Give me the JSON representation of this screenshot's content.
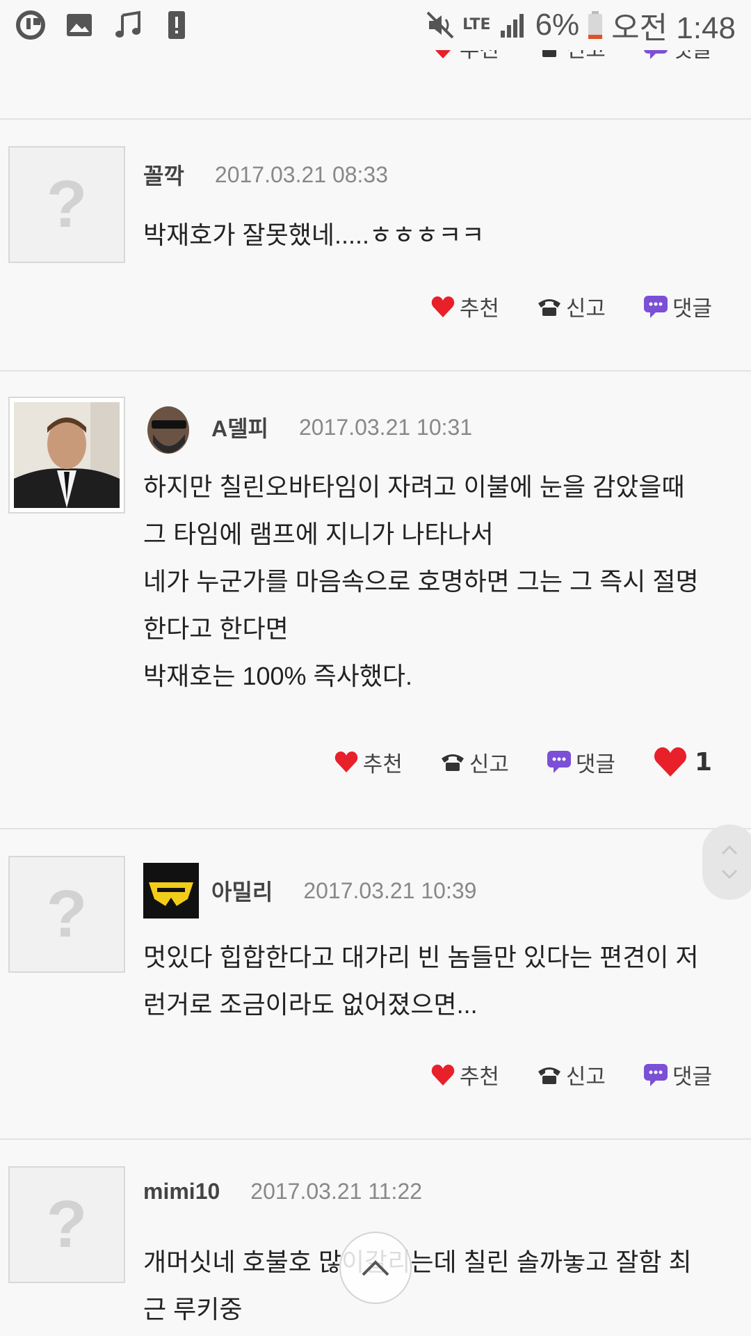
{
  "status_bar": {
    "battery": "6%",
    "time": "오전 1:48",
    "network": "LTE",
    "icons": [
      "u-plus-icon",
      "image-icon",
      "music-icon",
      "alert-icon",
      "mute-icon",
      "signal-icon",
      "battery-icon"
    ]
  },
  "actions": {
    "recommend": "추천",
    "report": "신고",
    "reply": "댓글"
  },
  "comments": [
    {
      "nick": "꼴깍",
      "date": "2017.03.21 08:33",
      "lines": [
        "박재호가 잘못했네.....ㅎㅎㅎㅋㅋ"
      ]
    },
    {
      "nick": "A델피",
      "date": "2017.03.21 10:31",
      "lines": [
        "하지만 칠린오바타임이 자려고 이불에 눈을 감았을때",
        "그 타임에 램프에 지니가 나타나서",
        "네가 누군가를 마음속으로 호명하면 그는 그 즉시 절명",
        "한다고 한다면",
        "박재호는 100% 즉사했다."
      ],
      "likes": "1"
    },
    {
      "nick": "아밀리",
      "date": "2017.03.21 10:39",
      "lines": [
        "멋있다 힙합한다고 대가리 빈 놈들만 있다는 편견이 저",
        "런거로 조금이라도 없어졌으면..."
      ]
    },
    {
      "nick": "mimi10",
      "date": "2017.03.21 11:22",
      "lines": [
        "개머싯네 호불호 많이갈리는데 칠린 솔까놓고 잘함 최",
        "근 루키중"
      ]
    }
  ],
  "colors": {
    "heart": "#e8202a",
    "reply_icon": "#7b4fd6",
    "background": "#f8f8f8",
    "divider": "#e2e2e2"
  }
}
